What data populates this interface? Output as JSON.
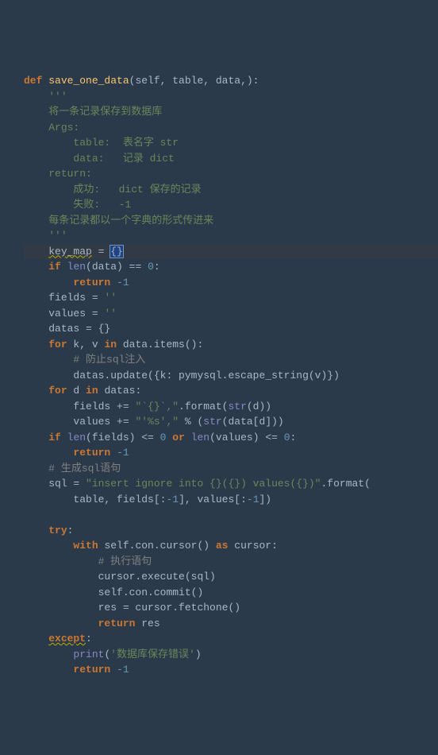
{
  "chart_data": null,
  "code": {
    "l1_def": "def",
    "l1_name": "save_one_data",
    "l1_params": "(self, table, data,):",
    "l2": "'''",
    "l3": "将一条记录保存到数据库",
    "l4": "Args:",
    "l5": "    table:  表名字 str",
    "l6": "    data:   记录 dict",
    "l7": "return:",
    "l8": "    成功:   dict 保存的记录",
    "l9": "    失败:   -1",
    "l10": "每条记录都以一个字典的形式传进来",
    "l11": "'''",
    "l12a": "key_map",
    "l12b": " = ",
    "l12c": "{}",
    "l13_if": "if",
    "l13_len": "len",
    "l13_rest": "(data) == ",
    "l13_zero": "0",
    "l14_ret": "return",
    "l14_neg1": " -1",
    "l15a": "fields = ",
    "l15b": "''",
    "l16a": "values = ",
    "l16b": "''",
    "l17a": "datas = {}",
    "l18_for": "for",
    "l18_kv": " k, v ",
    "l18_in": "in",
    "l18_items": " data.items():",
    "l19": "# 防止sql注入",
    "l20a": "datas.update({k: pymysql.escape_string(v)})",
    "l21_for": "for",
    "l21_d": " d ",
    "l21_in": "in",
    "l21_datas": " datas:",
    "l22a": "fields += ",
    "l22b": "\"`{}`,\"",
    "l22c": ".format(",
    "l22_str": "str",
    "l22d": "(d))",
    "l23a": "values += ",
    "l23b": "\"'%s',\"",
    "l23c": " % (",
    "l23_str": "str",
    "l23d": "(data[d]))",
    "l24_if": "if",
    "l24_len1": "len",
    "l24_a": "(fields) <= ",
    "l24_z1": "0",
    "l24_or": " or ",
    "l24_len2": "len",
    "l24_b": "(values) <= ",
    "l24_z2": "0",
    "l25_ret": "return",
    "l25_neg1": " -1",
    "l26": "# 生成sql语句",
    "l27a": "sql = ",
    "l27b": "\"insert ignore into {}({}) values({})\"",
    "l27c": ".format(",
    "l28a": "table, fields[:",
    "l28_neg1a": "-1",
    "l28b": "], values[:",
    "l28_neg1b": "-1",
    "l28c": "])",
    "l30_try": "try",
    "l31_with": "with",
    "l31_a": " self.con.cursor() ",
    "l31_as": "as",
    "l31_b": " cursor:",
    "l32": "# 执行语句",
    "l33": "cursor.execute(sql)",
    "l34": "self.con.commit()",
    "l35": "res = cursor.fetchone()",
    "l36_ret": "return",
    "l36_res": " res",
    "l37_except": "except",
    "l38_print": "print",
    "l38_a": "(",
    "l38_b": "'数据库保存错误'",
    "l38_c": ")",
    "l39_ret": "return",
    "l39_neg1": " -1"
  }
}
